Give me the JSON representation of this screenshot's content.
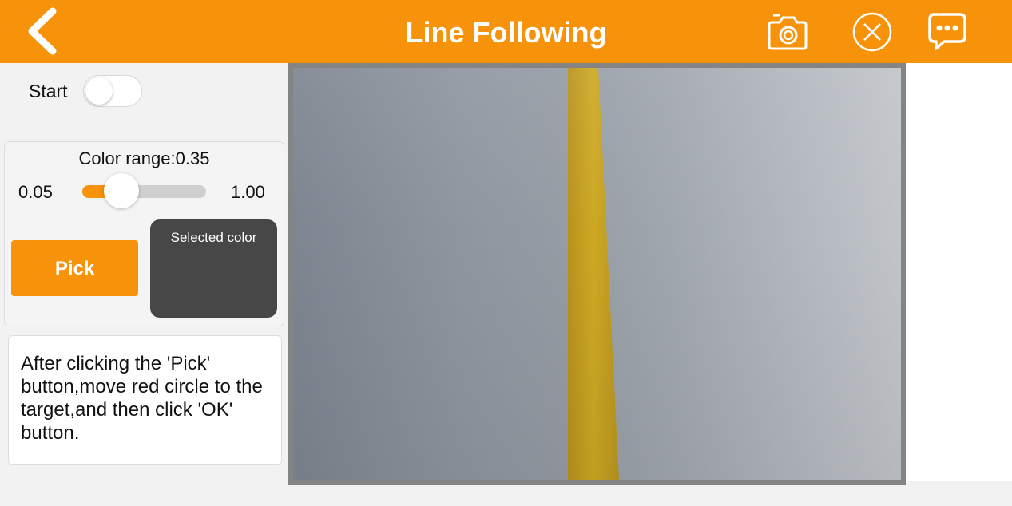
{
  "header": {
    "title": "Line Following",
    "back_icon": "chevron-left-icon",
    "actions": [
      {
        "icon": "camera-icon"
      },
      {
        "icon": "close-circle-icon"
      },
      {
        "icon": "chat-bubble-icon"
      }
    ],
    "background_color": "#f7930a"
  },
  "controls": {
    "start_label": "Start",
    "start_toggle_on": false
  },
  "color_range": {
    "title": "Color range:0.35",
    "min_label": "0.05",
    "max_label": "1.00",
    "min": 0.05,
    "max": 1.0,
    "value": 0.35
  },
  "pick": {
    "button_label": "Pick",
    "selected_color_label": "Selected color",
    "selected_color": "#474747"
  },
  "help": {
    "text": "After clicking the 'Pick' button,move red circle to the target,and then click 'OK' button."
  },
  "colors": {
    "accent": "#f7930a",
    "tape": "#c9a521"
  }
}
